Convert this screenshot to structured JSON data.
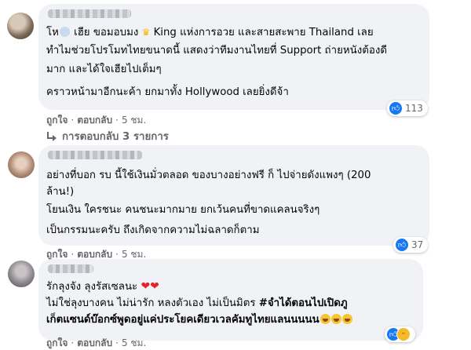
{
  "comments": [
    {
      "lines": [
        {
          "pre": "โห",
          "post": " เฮีย ขอมอบมง ",
          "tail": " King แห่งการอวย และสายสะพาย Thailand เลย"
        },
        "ทำไมช่วยโปรโมทไทยขนาดนี้ แสดงว่าทีมงานไทยที่ Support ถ่ายหนังต้องดี",
        "มาก และได้ใจเฮียไปเต็มๆ",
        "คราวหน้ามาอีกนะค้า ยกมาทั้ง Hollywood เลยยิ่งดีจ้า"
      ],
      "reaction_count": "113",
      "like_label": "ถูกใจ",
      "reply_label": "ตอบกลับ",
      "time": "5 ชม.",
      "replies_label": "การตอบกลับ 3 รายการ"
    },
    {
      "lines": [
        "อย่างที่บอก รบ นี้ใช้เงินมั่วตลอด ของบางอย่างฟรี ก็ ไปจ่ายดังแพงๆ (200",
        "ล้าน!)",
        "โยนเงิน ใครชนะ คนชนะมากมาย ยกเว้นคนที่ขาดแคลนจริงๆ",
        "เป็นกรรมนะครับ ถึงเกิดจากความไม่ฉลาดก็ตาม"
      ],
      "reaction_count": "37",
      "like_label": "ถูกใจ",
      "reply_label": "ตอบกลับ",
      "time": "5 ชม."
    },
    {
      "lines": [
        "รักลุงจัง ลุงรัสเซลนะ",
        {
          "pre": "ไม่ใช่ลุงบางคน ไม่น่ารัก หลงตัวเอง ไม่เป็นมิตร ",
          "hashtag": "#จำได้ตอนไปเปิดภู"
        },
        "เก็ตแซนด์บ๊อกซ์พูดอยู่แค่ประโยคเดียวเวลคัมทูไทยแลนนนนน"
      ],
      "like_label": "ถูกใจ",
      "reply_label": "ตอบกลับ",
      "time": "5 ชม."
    }
  ],
  "icons": {
    "like": "like-icon",
    "haha": "haha-icon",
    "heart": "heart-emoji",
    "laugh": "laugh-emoji",
    "scream": "scream-emoji",
    "crown": "crown-emoji",
    "reply_arrow": "reply-arrow-icon"
  },
  "colors": {
    "bubble": "#f0f2f5",
    "meta": "#65676b",
    "like": "#1877f2",
    "heart": "#e3242b"
  }
}
